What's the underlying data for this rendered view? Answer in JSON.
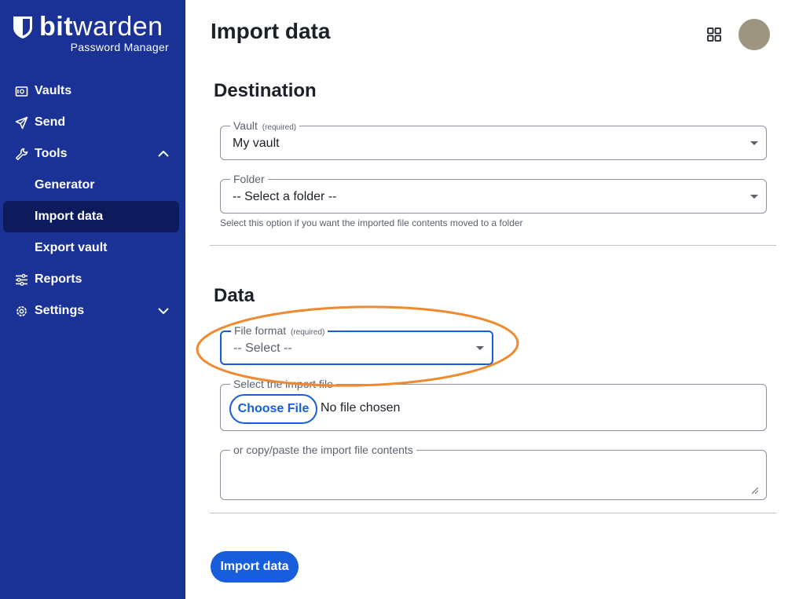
{
  "brand": {
    "name_bold": "bit",
    "name_light": "warden",
    "subtitle": "Password Manager"
  },
  "sidebar": {
    "items": [
      {
        "label": "Vaults",
        "icon": "vault-icon"
      },
      {
        "label": "Send",
        "icon": "send-icon"
      },
      {
        "label": "Tools",
        "icon": "wrench-icon",
        "expanded": true
      },
      {
        "label": "Generator"
      },
      {
        "label": "Import data",
        "active": true
      },
      {
        "label": "Export vault"
      },
      {
        "label": "Reports",
        "icon": "sliders-icon"
      },
      {
        "label": "Settings",
        "icon": "gear-icon",
        "expanded": false
      }
    ]
  },
  "header": {
    "title": "Import data"
  },
  "destination": {
    "title": "Destination",
    "vault_label": "Vault",
    "vault_required": "(required)",
    "vault_value": "My vault",
    "folder_label": "Folder",
    "folder_value": "-- Select a folder --",
    "folder_hint": "Select this option if you want the imported file contents moved to a folder"
  },
  "data": {
    "title": "Data",
    "format_label": "File format",
    "format_required": "(required)",
    "format_value": "-- Select --",
    "file_label": "Select the import file",
    "choose_file": "Choose File",
    "no_file": "No file chosen",
    "paste_label": "or copy/paste the import file contents"
  },
  "submit_label": "Import data",
  "colors": {
    "sidebar_bg": "#1a3296",
    "sidebar_active": "#0d1a5b",
    "primary": "#175ddc",
    "highlight": "#f08a30",
    "avatar": "#9e9581"
  }
}
